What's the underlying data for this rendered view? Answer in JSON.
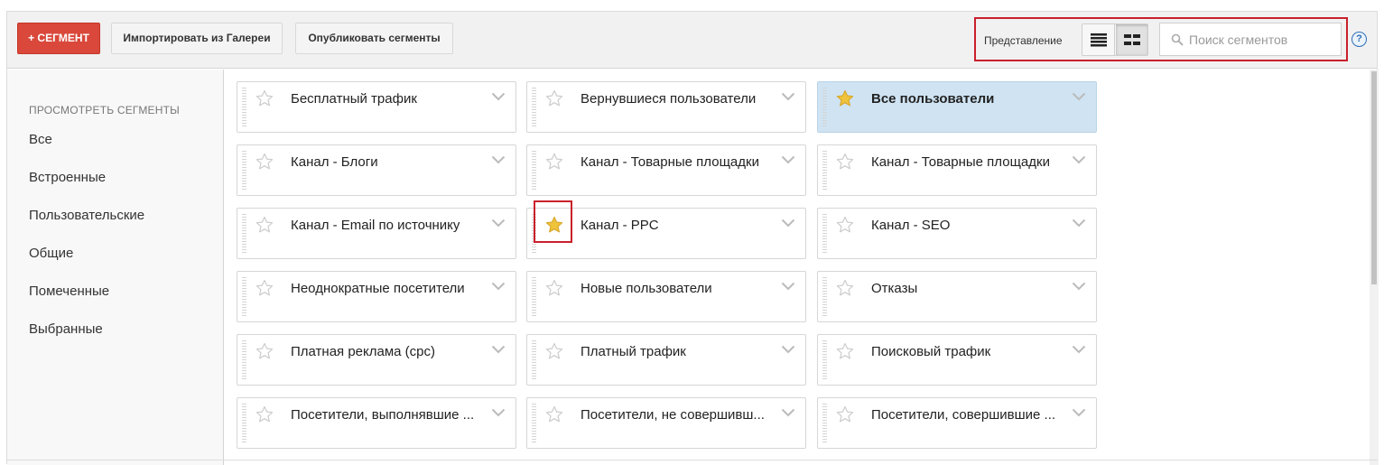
{
  "toolbar": {
    "new_segment": "+ СЕГМЕНТ",
    "import": "Импортировать из Галереи",
    "publish": "Опубликовать сегменты",
    "view_label": "Представление",
    "search_placeholder": "Поиск сегментов",
    "help": "?"
  },
  "sidebar": {
    "heading": "ПРОСМОТРЕТЬ СЕГМЕНТЫ",
    "items": [
      {
        "label": "Все",
        "active": true
      },
      {
        "label": "Встроенные",
        "active": false
      },
      {
        "label": "Пользовательские",
        "active": false
      },
      {
        "label": "Общие",
        "active": false
      },
      {
        "label": "Помеченные",
        "active": false
      },
      {
        "label": "Выбранные",
        "active": false
      }
    ]
  },
  "segments": [
    {
      "label": "Бесплатный трафик",
      "starred": false,
      "selected": false
    },
    {
      "label": "Вернувшиеся пользователи",
      "starred": false,
      "selected": false
    },
    {
      "label": "Все пользователи",
      "starred": true,
      "selected": true
    },
    {
      "label": "Канал - Блоги",
      "starred": false,
      "selected": false
    },
    {
      "label": "Канал - Товарные площадки",
      "starred": false,
      "selected": false
    },
    {
      "label": "Канал - Товарные площадки",
      "starred": false,
      "selected": false
    },
    {
      "label": "Канал - Email по источнику",
      "starred": false,
      "selected": false
    },
    {
      "label": "Канал - PPC",
      "starred": true,
      "selected": false
    },
    {
      "label": "Канал - SEO",
      "starred": false,
      "selected": false
    },
    {
      "label": "Неоднократные посетители",
      "starred": false,
      "selected": false
    },
    {
      "label": "Новые пользователи",
      "starred": false,
      "selected": false
    },
    {
      "label": "Отказы",
      "starred": false,
      "selected": false
    },
    {
      "label": "Платная реклама (cpc)",
      "starred": false,
      "selected": false
    },
    {
      "label": "Платный трафик",
      "starred": false,
      "selected": false
    },
    {
      "label": "Поисковый трафик",
      "starred": false,
      "selected": false
    },
    {
      "label": "Посетители, выполнявшие ...",
      "starred": false,
      "selected": false
    },
    {
      "label": "Посетители, не совершивш...",
      "starred": false,
      "selected": false
    },
    {
      "label": "Посетители, совершившие ...",
      "starred": false,
      "selected": false
    }
  ],
  "colors": {
    "accent_red": "#d9483b",
    "highlight_outline": "#c9202b",
    "star_filled": "#f0c33c",
    "star_empty": "#cccccc",
    "selected_card": "#cfe3f2"
  }
}
